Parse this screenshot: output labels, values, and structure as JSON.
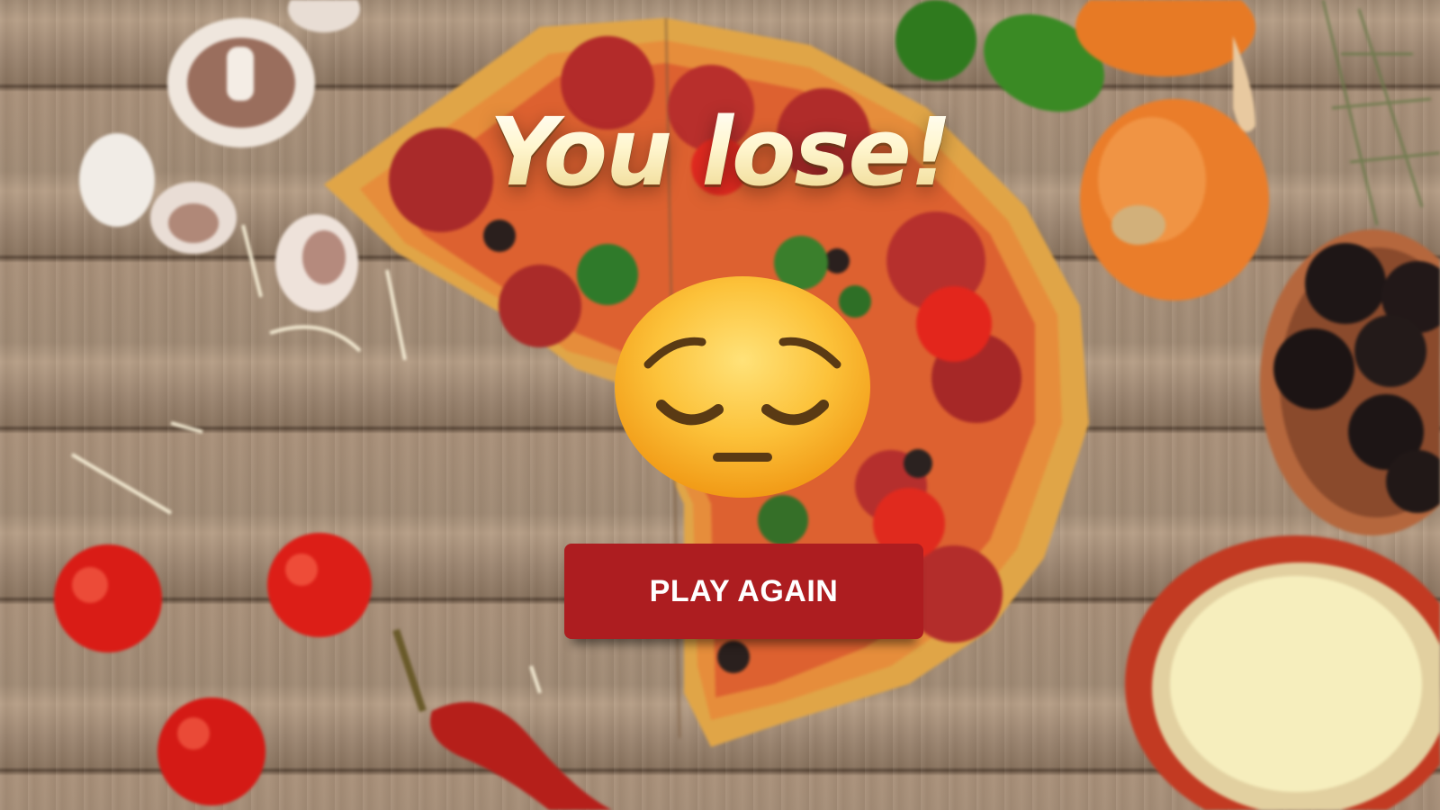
{
  "screen": {
    "title": "You lose!",
    "result_emoji": "pensive-face",
    "play_again_label": "PLAY AGAIN"
  },
  "colors": {
    "button": "#ad1d20",
    "button_text": "#ffffff",
    "title_fill": "#fbf2c4",
    "emoji_face": "#fcc23a"
  }
}
